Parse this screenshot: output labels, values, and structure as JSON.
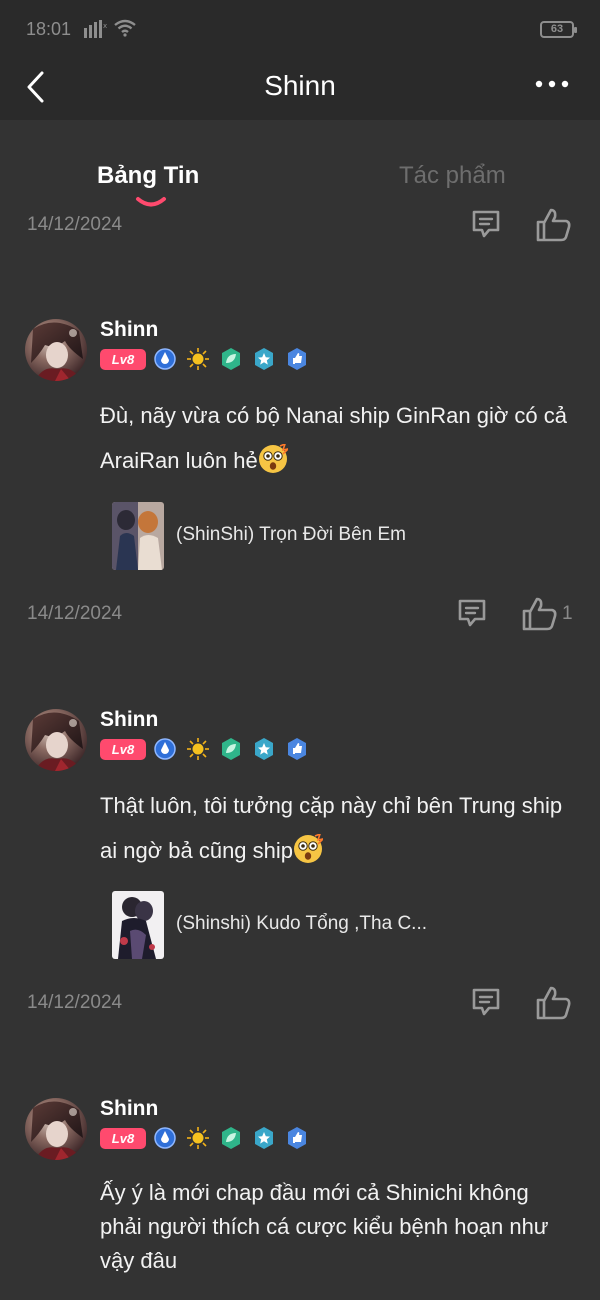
{
  "status_bar": {
    "time": "18:01",
    "battery": "63"
  },
  "header": {
    "title": "Shinn"
  },
  "tabs": [
    {
      "label": "Bảng Tin",
      "active": true
    },
    {
      "label": "Tác phẩm",
      "active": false
    }
  ],
  "top_meta": {
    "date": "14/12/2024"
  },
  "posts": [
    {
      "username": "Shinn",
      "level": "Lv8",
      "text": "Đù, nãy vừa có bộ Nanai ship GinRan giờ có cả AraiRan luôn hẻ",
      "emoji": "astonished-face-icon",
      "work_title": "(ShinShi) Trọn Đời Bên Em",
      "date": "14/12/2024",
      "like_count": "1"
    },
    {
      "username": "Shinn",
      "level": "Lv8",
      "text": "Thật luôn, tôi tưởng cặp này chỉ bên Trung ship ai ngờ bả cũng ship",
      "emoji": "astonished-face-icon",
      "work_title": "(Shinshi) Kudo Tổng ,Tha C...",
      "date": "14/12/2024",
      "like_count": ""
    },
    {
      "username": "Shinn",
      "level": "Lv8",
      "text": "Ấy ý là mới chap đầu mới cả Shinichi không phải người thích cá cược kiểu bệnh hoạn như vậy đâu"
    }
  ],
  "colors": {
    "background": "#333333",
    "header_bg": "#2a2a2a",
    "level_badge": "#ff4a6e",
    "tab_indicator": "#ff4a6e",
    "muted_text": "#8a8a8a"
  }
}
